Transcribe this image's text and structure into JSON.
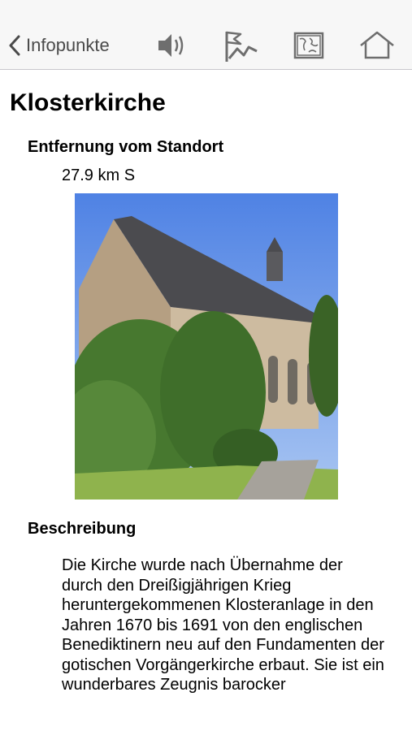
{
  "nav": {
    "back_label": "Infopunkte",
    "icons": [
      "speaker-icon",
      "route-flag-icon",
      "map-icon",
      "home-icon"
    ]
  },
  "page": {
    "title": "Klosterkirche",
    "distance_heading": "Entfernung vom Standort",
    "distance_value": "27.9 km S",
    "description_heading": "Beschreibung",
    "description_text": "Die Kirche wurde nach Übernahme der durch den Dreißigjährigen Krieg heruntergekommenen Klosteranlage in den Jahren 1670 bis 1691 von den englischen Benediktinern neu auf den Fundamenten der gotischen Vorgängerkirche erbaut. Sie ist ein wunderbares Zeugnis barocker"
  },
  "colors": {
    "icon": "#6e6e6e",
    "navbar_bg": "#f7f7f7",
    "sky": "#5f8fe6",
    "foliage": "#3d6b2a"
  }
}
